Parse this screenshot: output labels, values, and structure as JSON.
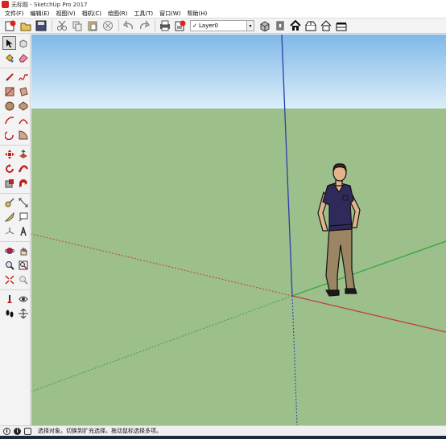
{
  "window": {
    "title": "无标题 - SketchUp Pro 2017"
  },
  "menu": [
    "文件(F)",
    "编辑(E)",
    "视图(V)",
    "相机(C)",
    "绘图(R)",
    "工具(T)",
    "窗口(W)",
    "帮助(H)"
  ],
  "toolbar": {
    "layer_label": "Layer0",
    "layer_checked": "✓",
    "dropdown_arrow": "▾"
  },
  "status": {
    "message": "选择对象。切换到扩充选择。拖动鼠标选择多项。",
    "icon1": "i",
    "icon2": "i"
  },
  "colors": {
    "sky": "#8fc3ea",
    "ground": "#9dbf8c",
    "axis_red": "#c04040",
    "axis_green": "#3aa63a",
    "axis_blue": "#2b3fa8"
  }
}
